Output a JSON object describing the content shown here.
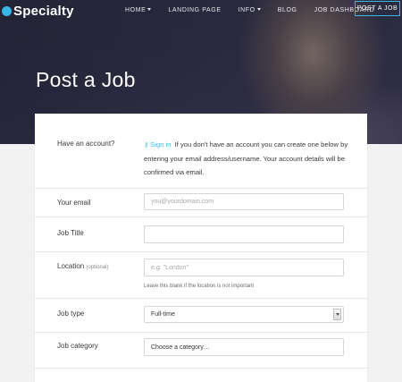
{
  "brand": {
    "name": "Specialty",
    "dot_color": "#39b6e6"
  },
  "nav": {
    "items": [
      {
        "label": "Home",
        "has_caret": true
      },
      {
        "label": "Landing Page",
        "has_caret": false
      },
      {
        "label": "Info",
        "has_caret": true
      },
      {
        "label": "Blog",
        "has_caret": false
      },
      {
        "label": "Job Dashboard",
        "has_caret": false
      }
    ],
    "post_button": "Post a Job"
  },
  "page": {
    "title": "Post a Job"
  },
  "form": {
    "account": {
      "label": "Have an account?",
      "signin_icon": "key-icon",
      "signin_label": "Sign in",
      "text": "If you don't have an account you can create one below by entering your email address/username. Your account details will be confirmed via email."
    },
    "email": {
      "label": "Your email",
      "placeholder": "you@yourdomain.com"
    },
    "job_title": {
      "label": "Job Title",
      "placeholder": ""
    },
    "location": {
      "label": "Location",
      "optional": "(optional)",
      "placeholder": "e.g. \"London\"",
      "help": "Leave this blank if the location is not important"
    },
    "job_type": {
      "label": "Job type",
      "value": "Full-time"
    },
    "job_category": {
      "label": "Job category",
      "placeholder": "Choose a category…"
    }
  },
  "colors": {
    "accent": "#39b6e6",
    "hero_bg": "#2b2b40"
  }
}
